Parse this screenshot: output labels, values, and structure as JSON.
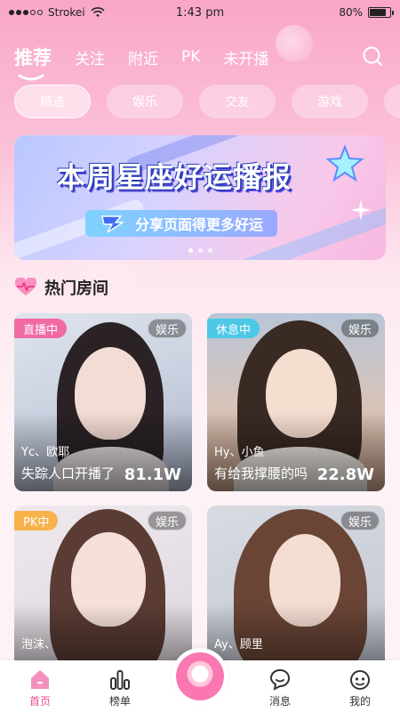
{
  "status_bar": {
    "carrier": "Strokei",
    "time": "1:43 pm",
    "battery": "80%",
    "battery_level": 0.8
  },
  "top_nav": {
    "tabs": [
      "推荐",
      "关注",
      "附近",
      "PK",
      "未开播"
    ],
    "active_index": 0
  },
  "categories": {
    "chips": [
      "精选",
      "娱乐",
      "交友",
      "游戏"
    ],
    "active_index": 0
  },
  "banner": {
    "title": "本周星座好运播报",
    "subtitle": "分享页面得更多好运",
    "page_count": 3,
    "active_page": 0
  },
  "section": {
    "title": "热门房间"
  },
  "rooms": [
    {
      "status": "直播中",
      "status_color": "#f26aa4",
      "category": "娱乐",
      "host": "Yc、欧耶",
      "title": "失踪人口开播了",
      "count": "81.1W"
    },
    {
      "status": "休息中",
      "status_color": "#4cc8e6",
      "category": "娱乐",
      "host": "Hy、小鱼",
      "title": "有给我撑腰的吗",
      "count": "22.8W"
    },
    {
      "status": "PK中",
      "status_color": "#f7b24a",
      "category": "娱乐",
      "host": "泡沫、",
      "title": "",
      "count": ""
    },
    {
      "status": "",
      "status_color": "",
      "category": "娱乐",
      "host": "Ay、顾里",
      "title": "",
      "count": ""
    }
  ],
  "tab_bar": {
    "items": [
      "首页",
      "榜单",
      "消息",
      "我的"
    ],
    "active_index": 0
  },
  "colors": {
    "accent": "#f0508f",
    "nav_bg": "#f9a6c8"
  }
}
